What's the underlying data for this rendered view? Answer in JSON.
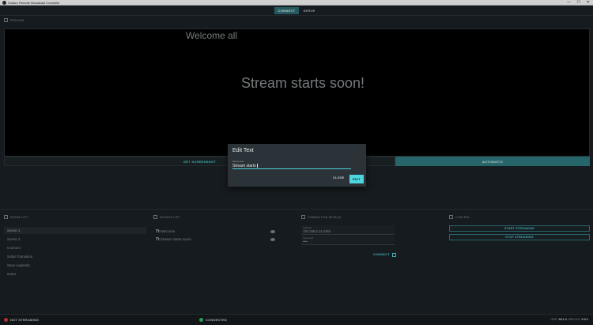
{
  "window": {
    "title": "Subaru Remote Broadcast Controller",
    "minimize": "—",
    "maximize": "☐",
    "close": "✕"
  },
  "tabs": [
    {
      "label": "CONNECT",
      "active": true
    },
    {
      "label": "SERVE",
      "active": false
    }
  ],
  "preview": {
    "header": "PREVIEW",
    "text_top": "Welcome all",
    "text_center": "Stream starts soon!"
  },
  "actions": {
    "screenshot": "GET SCREENSHOT",
    "automatic": "AUTOMATIC"
  },
  "scenes": {
    "header": "SCENE LIST",
    "items": [
      "Scene 1",
      "Scene 2",
      "Connect",
      "Subiri Transition",
      "Save Legends",
      "Outro"
    ],
    "selected_index": 0
  },
  "sources": {
    "header": "SOURCE LIST",
    "items": [
      {
        "icon": "Tt",
        "label": "Welcome"
      },
      {
        "icon": "Tt",
        "label": "Stream starts soon!"
      }
    ]
  },
  "connection": {
    "header": "CONNECTION DETAILS",
    "address_label": "Address",
    "address_value": "192.168.0.14:4455",
    "password_label": "Password",
    "password_value": "••••",
    "connect_button": "CONNECT"
  },
  "controls": {
    "header": "CONTROL",
    "start": "START STREAMING",
    "stop": "STOP STREAMING"
  },
  "status": {
    "stream": "NOT STREAMING",
    "connection": "CONNECTED",
    "obs_label": "OBS:",
    "obs_version": "28.1.2",
    "ws_label": "OBS-WS:",
    "ws_version": "5.0.1"
  },
  "modal": {
    "title": "Edit Text",
    "field_label": "Scene text",
    "field_value": "Stream starts",
    "close": "CLOSE",
    "edit": "EDIT"
  },
  "colors": {
    "accent": "#4ed4dc",
    "accent_dark": "#2f7c80",
    "bg": "#1c2226",
    "error": "#d73a3a",
    "success": "#33c268"
  }
}
